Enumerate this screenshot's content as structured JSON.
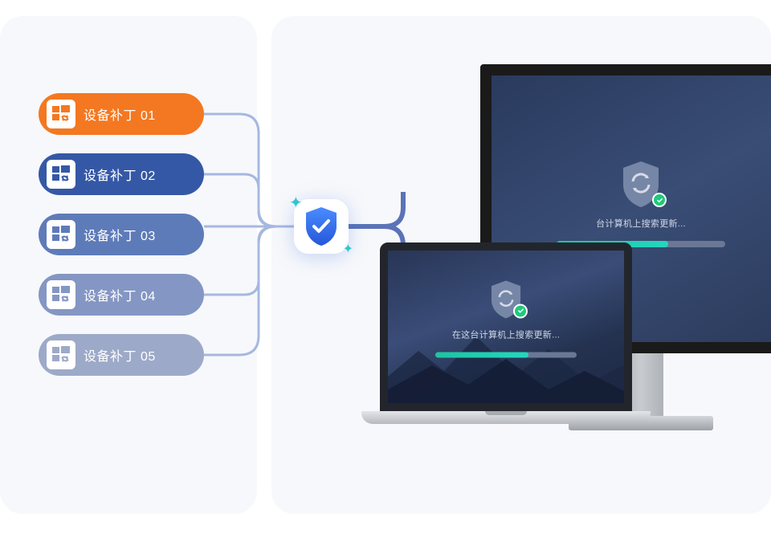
{
  "patches": [
    {
      "label": "设备补丁 01",
      "color": "#f47821"
    },
    {
      "label": "设备补丁 02",
      "color": "#3558a6"
    },
    {
      "label": "设备补丁 03",
      "color": "#5e7bb9"
    },
    {
      "label": "设备补丁 04",
      "color": "#8496c3"
    },
    {
      "label": "设备补丁 05",
      "color": "#9da9c8"
    }
  ],
  "devices": {
    "monitor": {
      "status_text": "台计算机上搜索更新...",
      "progress_percent": 66
    },
    "laptop": {
      "status_text": "在这台计算机上搜索更新...",
      "progress_percent": 66
    }
  },
  "icons": {
    "windows_sync": "windows-sync-icon",
    "shield_check": "shield-check-icon",
    "sync": "sync-icon"
  }
}
